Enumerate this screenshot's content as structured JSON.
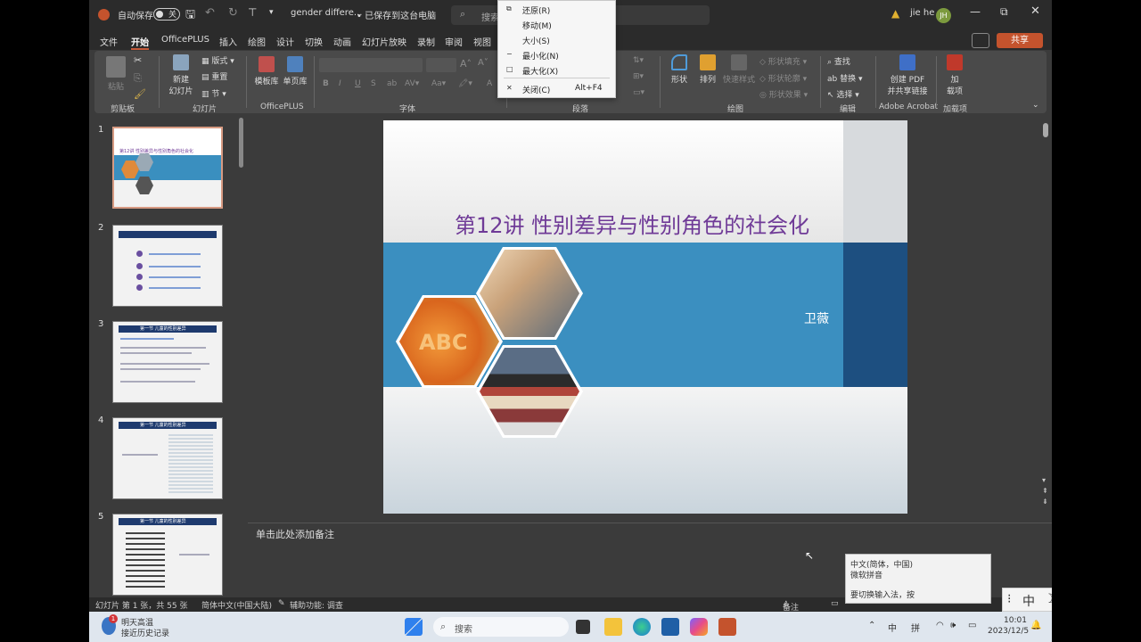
{
  "titlebar": {
    "autosave_label": "自动保存",
    "autosave_state": "关",
    "filename": "gender differe...",
    "save_status": "• 已保存到这台电脑",
    "search_placeholder": "搜索",
    "user_name": "jie he",
    "user_initials": "JH"
  },
  "context_menu": {
    "items": [
      {
        "glyph": "⧉",
        "label": "还原(R)",
        "accel": ""
      },
      {
        "glyph": "",
        "label": "移动(M)",
        "accel": ""
      },
      {
        "glyph": "",
        "label": "大小(S)",
        "accel": ""
      },
      {
        "glyph": "−",
        "label": "最小化(N)",
        "accel": ""
      },
      {
        "glyph": "□",
        "label": "最大化(X)",
        "accel": ""
      },
      {
        "glyph": "✕",
        "label": "关闭(C)",
        "accel": "Alt+F4"
      }
    ]
  },
  "menu_tabs": [
    "文件",
    "开始",
    "OfficePLUS",
    "插入",
    "绘图",
    "设计",
    "切换",
    "动画",
    "幻灯片放映",
    "录制",
    "审阅",
    "视图"
  ],
  "active_tab": "开始",
  "share_label": "共享",
  "ribbon": {
    "groups": {
      "clipboard": "剪贴板",
      "slides": "幻灯片",
      "officeplus": "OfficePLUS",
      "font": "字体",
      "paragraph": "段落",
      "drawing": "绘图",
      "editing": "编辑",
      "acrobat": "Adobe Acrobat",
      "addins": "加载项"
    },
    "buttons": {
      "paste": "粘贴",
      "new_slide_1": "新建",
      "new_slide_2": "幻灯片",
      "layout": "版式",
      "reset": "重置",
      "section": "节",
      "template_lib": "模板库",
      "single_page_lib": "单页库",
      "shape": "形状",
      "arrange": "排列",
      "quick_styles": "快速样式",
      "shape_fill": "形状填充",
      "shape_outline": "形状轮廓",
      "shape_effects": "形状效果",
      "find": "查找",
      "replace": "替换",
      "select": "选择",
      "create_pdf_1": "创建 PDF",
      "create_pdf_2": "并共享链接",
      "addins_1": "加",
      "addins_2": "载项"
    }
  },
  "thumbnails": [
    {
      "number": "1",
      "caption": "第12讲 性别差异与性别角色的社会化"
    },
    {
      "number": "2",
      "caption": ""
    },
    {
      "number": "3",
      "caption": "第一节 儿童的性别差异"
    },
    {
      "number": "4",
      "caption": "第一节 儿童的性别差异"
    },
    {
      "number": "5",
      "caption": "第一节 儿童的性别差异"
    }
  ],
  "slide": {
    "title": "第12讲 性别差异与性别角色的社会化",
    "author": "卫薇"
  },
  "notes_placeholder": "单击此处添加备注",
  "statusbar": {
    "slide_info": "幻灯片 第 1 张，共 55 张",
    "language": "简体中文(中国大陆)",
    "accessibility": "辅助功能: 调查",
    "notes": "备注"
  },
  "ime_popup": {
    "line1": "中文(简体，中国)",
    "line2": "微软拼音",
    "line3": "要切换输入法，按"
  },
  "ime_bar": {
    "mode": "中",
    "simplified": "简"
  },
  "taskbar": {
    "weather_line1": "明天高温",
    "weather_line2": "接近历史记录",
    "search_label": "搜索",
    "lang1": "中",
    "lang2": "拼",
    "time": "10:01",
    "date": "2023/12/5",
    "badge": "1"
  }
}
